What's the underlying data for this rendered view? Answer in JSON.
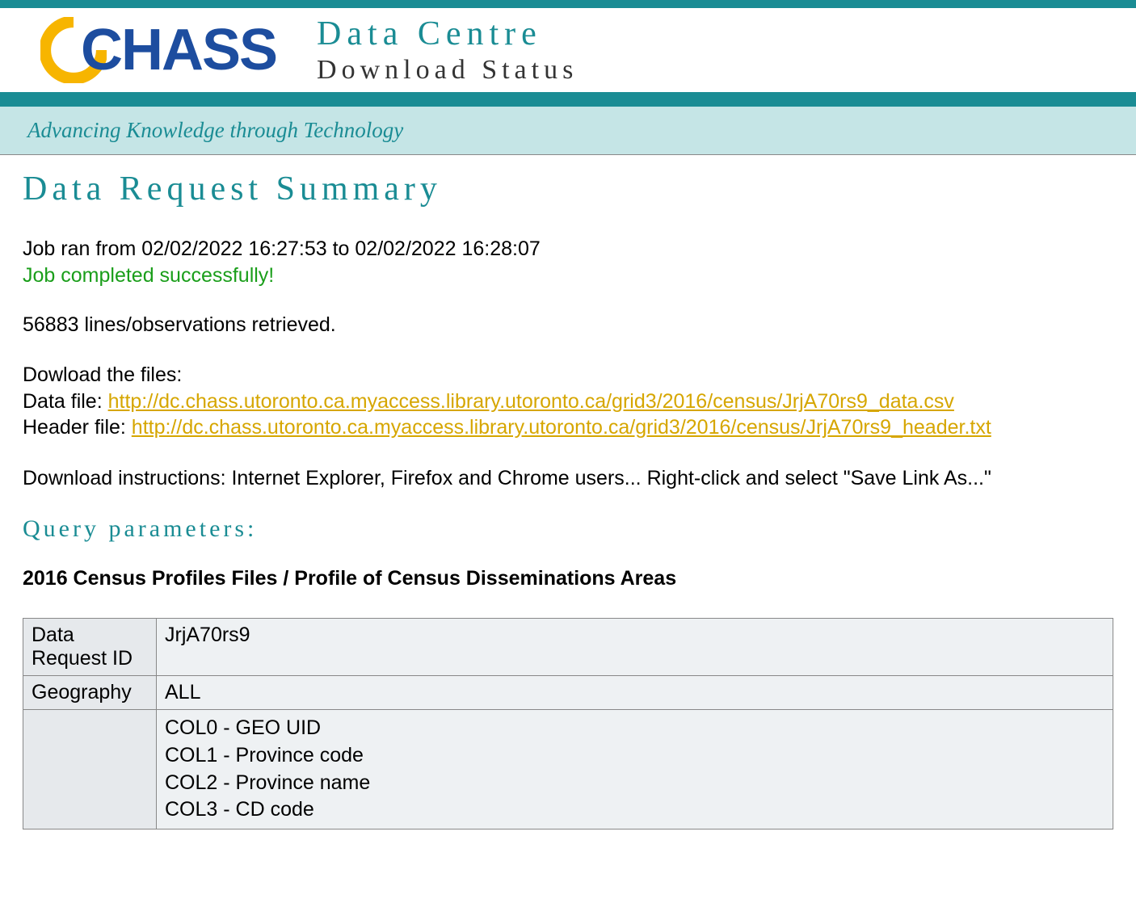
{
  "header": {
    "logo_text": "CHASS",
    "title": "Data Centre",
    "subtitle": "Download Status"
  },
  "tagline": "Advancing Knowledge through Technology",
  "main_heading": "Data Request Summary",
  "job": {
    "run_text": "Job ran from 02/02/2022 16:27:53 to 02/02/2022 16:28:07",
    "status_text": "Job completed successfully!",
    "lines_text": "56883 lines/observations retrieved."
  },
  "downloads": {
    "intro": "Dowload the files:",
    "data_label": "Data file: ",
    "data_url": "http://dc.chass.utoronto.ca.myaccess.library.utoronto.ca/grid3/2016/census/JrjA70rs9_data.csv",
    "header_label": "Header file: ",
    "header_url": "http://dc.chass.utoronto.ca.myaccess.library.utoronto.ca/grid3/2016/census/JrjA70rs9_header.txt"
  },
  "instructions": "Download instructions: Internet Explorer, Firefox and Chrome users... Right-click and select \"Save Link As...\"",
  "query": {
    "heading": "Query parameters:",
    "dataset_title": "2016 Census Profiles Files / Profile of Census Disseminations Areas",
    "rows": {
      "request_id_key": "Data Request ID",
      "request_id_val": "JrjA70rs9",
      "geography_key": "Geography",
      "geography_val": "ALL",
      "cols_key": "",
      "cols": [
        "COL0 - GEO UID",
        "COL1 - Province code",
        "COL2 - Province name",
        "COL3 - CD code"
      ]
    }
  }
}
